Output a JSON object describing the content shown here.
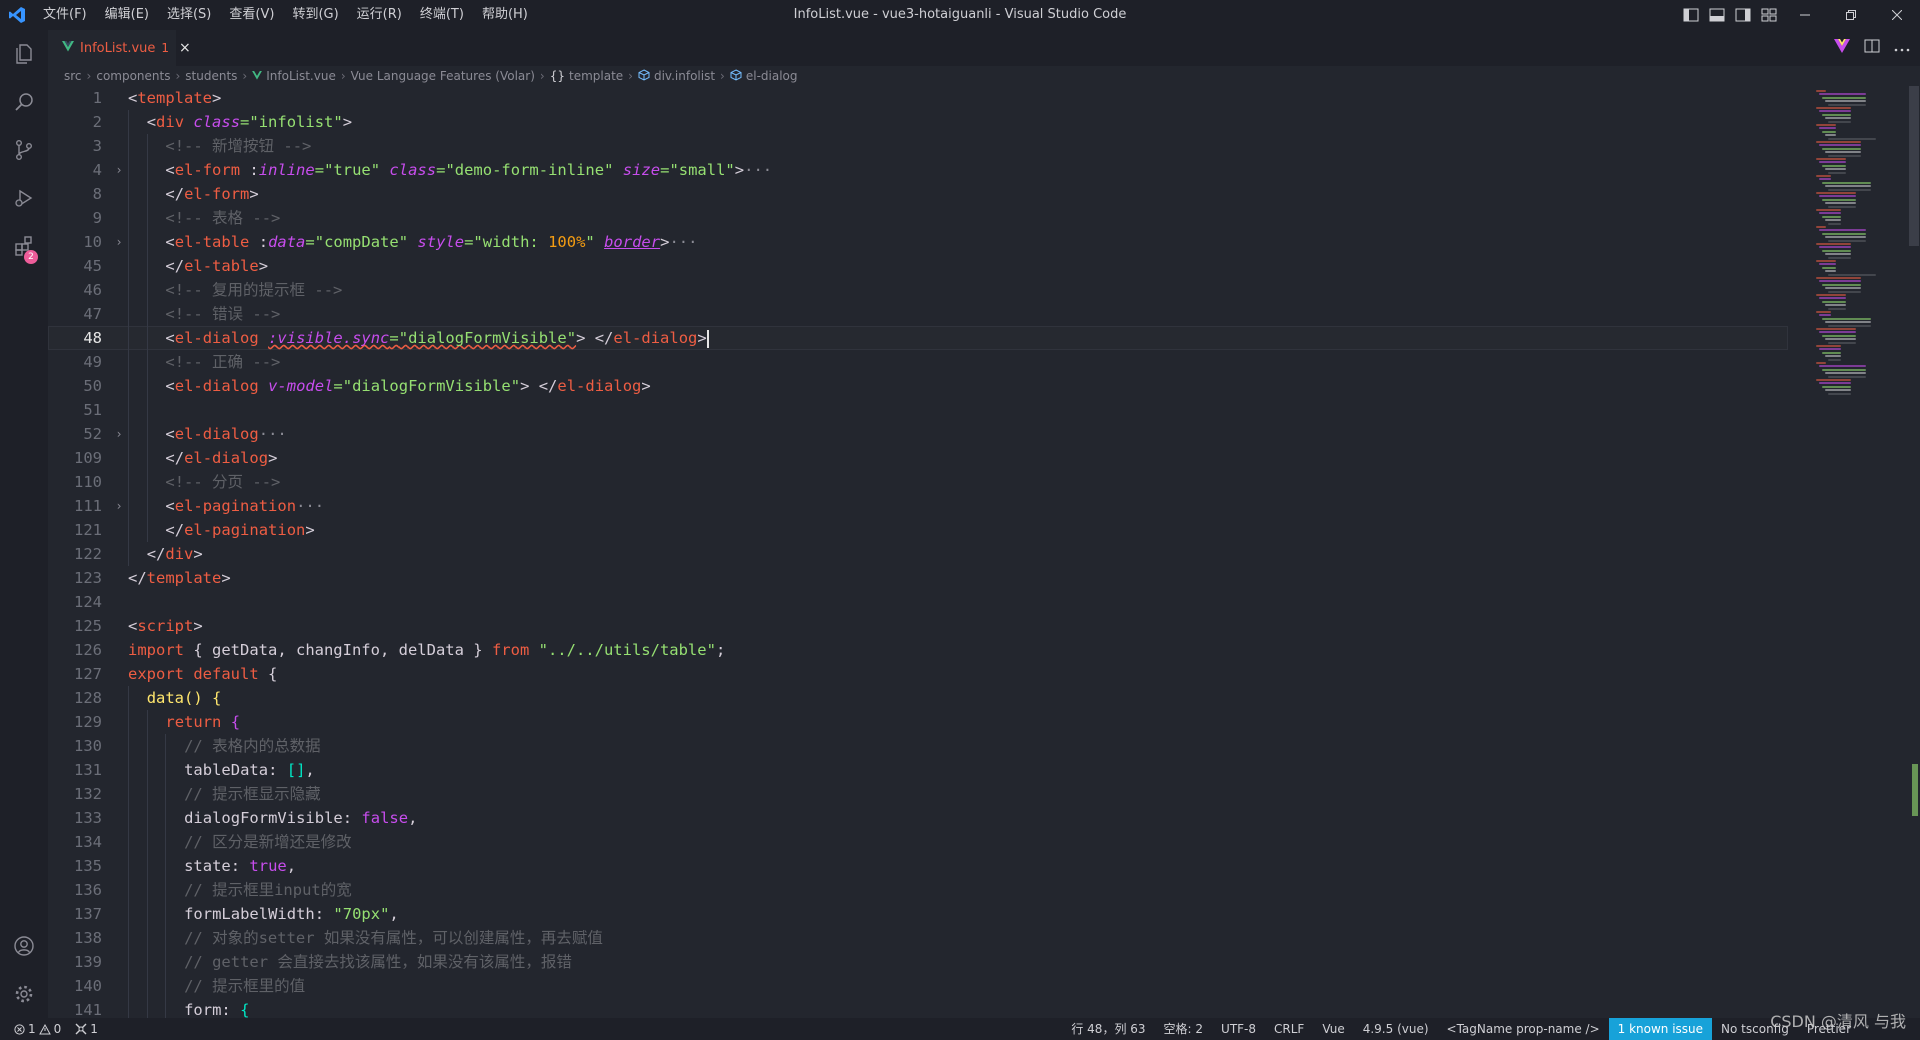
{
  "window": {
    "title": "InfoList.vue - vue3-hotaiguanli - Visual Studio Code",
    "menu": [
      "文件(F)",
      "编辑(E)",
      "选择(S)",
      "查看(V)",
      "转到(G)",
      "运行(R)",
      "终端(T)",
      "帮助(H)"
    ]
  },
  "activity": {
    "extensions_badge": "2"
  },
  "tabs": [
    {
      "label": "InfoList.vue",
      "problems": "1",
      "close": "×"
    }
  ],
  "breadcrumb": [
    "src",
    "components",
    "students",
    "InfoList.vue",
    "Vue Language Features (Volar)",
    "template",
    "div.infolist",
    "el-dialog"
  ],
  "editor": {
    "current_line": "48",
    "lines": [
      {
        "num": "1",
        "fold": "",
        "indent": 0,
        "tokens": [
          [
            "t-punc",
            "<"
          ],
          [
            "t-tag",
            "template"
          ],
          [
            "t-punc",
            ">"
          ]
        ]
      },
      {
        "num": "2",
        "fold": "",
        "indent": 1,
        "tokens": [
          [
            "t-punc",
            "<"
          ],
          [
            "t-tag",
            "div"
          ],
          [
            "t-punc",
            " "
          ],
          [
            "t-attr",
            "class"
          ],
          [
            "t-eq",
            "="
          ],
          [
            "t-str",
            "\"infolist\""
          ],
          [
            "t-punc",
            ">"
          ]
        ]
      },
      {
        "num": "3",
        "fold": "",
        "indent": 2,
        "tokens": [
          [
            "t-comment",
            "<!-- 新增按钮 -->"
          ]
        ]
      },
      {
        "num": "4",
        "fold": "›",
        "indent": 2,
        "tokens": [
          [
            "t-punc",
            "<"
          ],
          [
            "t-tag",
            "el-form"
          ],
          [
            "t-punc",
            " :"
          ],
          [
            "t-attr",
            "inline"
          ],
          [
            "t-eq",
            "="
          ],
          [
            "t-str",
            "\"true\""
          ],
          [
            "t-punc",
            " "
          ],
          [
            "t-attr",
            "class"
          ],
          [
            "t-eq",
            "="
          ],
          [
            "t-str",
            "\"demo-form-inline\""
          ],
          [
            "t-punc",
            " "
          ],
          [
            "t-attr",
            "size"
          ],
          [
            "t-eq",
            "="
          ],
          [
            "t-str",
            "\"small\""
          ],
          [
            "t-punc",
            ">"
          ],
          [
            "t-ellipsis",
            "···"
          ]
        ]
      },
      {
        "num": "8",
        "fold": "",
        "indent": 2,
        "tokens": [
          [
            "t-punc",
            "</"
          ],
          [
            "t-tag",
            "el-form"
          ],
          [
            "t-punc",
            ">"
          ]
        ]
      },
      {
        "num": "9",
        "fold": "",
        "indent": 2,
        "tokens": [
          [
            "t-comment",
            "<!-- 表格 -->"
          ]
        ]
      },
      {
        "num": "10",
        "fold": "›",
        "indent": 2,
        "tokens": [
          [
            "t-punc",
            "<"
          ],
          [
            "t-tag",
            "el-table"
          ],
          [
            "t-punc",
            " :"
          ],
          [
            "t-attr",
            "data"
          ],
          [
            "t-eq",
            "="
          ],
          [
            "t-str",
            "\"compDate\""
          ],
          [
            "t-punc",
            " "
          ],
          [
            "t-attr",
            "style"
          ],
          [
            "t-eq",
            "="
          ],
          [
            "t-str",
            "\"width: "
          ],
          [
            "t-num",
            "100%"
          ],
          [
            "t-str",
            "\""
          ],
          [
            "t-punc",
            " "
          ],
          [
            "t-attr ul",
            "border"
          ],
          [
            "t-punc",
            ">"
          ],
          [
            "t-ellipsis",
            "···"
          ]
        ]
      },
      {
        "num": "45",
        "fold": "",
        "indent": 2,
        "tokens": [
          [
            "t-punc",
            "</"
          ],
          [
            "t-tag",
            "el-table"
          ],
          [
            "t-punc",
            ">"
          ]
        ]
      },
      {
        "num": "46",
        "fold": "",
        "indent": 2,
        "tokens": [
          [
            "t-comment",
            "<!-- 复用的提示框 -->"
          ]
        ]
      },
      {
        "num": "47",
        "fold": "",
        "indent": 2,
        "tokens": [
          [
            "t-comment",
            "<!-- 错误 -->"
          ]
        ]
      },
      {
        "num": "48",
        "fold": "",
        "indent": 2,
        "tokens": [
          [
            "t-punc",
            "<"
          ],
          [
            "t-tag",
            "el-dialog"
          ],
          [
            "t-punc",
            " "
          ],
          [
            "t-attr squiggle",
            ":visible.sync"
          ],
          [
            "t-eq squiggle",
            "="
          ],
          [
            "t-str squiggle",
            "\"dialogFormVisible\""
          ],
          [
            "t-punc",
            "> </"
          ],
          [
            "t-tag",
            "el-dialog"
          ],
          [
            "t-punc",
            ">"
          ],
          [
            "caret",
            ""
          ]
        ]
      },
      {
        "num": "49",
        "fold": "",
        "indent": 2,
        "tokens": [
          [
            "t-comment",
            "<!-- 正确 -->"
          ]
        ]
      },
      {
        "num": "50",
        "fold": "",
        "indent": 2,
        "tokens": [
          [
            "t-punc",
            "<"
          ],
          [
            "t-tag",
            "el-dialog"
          ],
          [
            "t-punc",
            " "
          ],
          [
            "t-attr",
            "v-model"
          ],
          [
            "t-eq",
            "="
          ],
          [
            "t-str",
            "\"dialogFormVisible\""
          ],
          [
            "t-punc",
            "> </"
          ],
          [
            "t-tag",
            "el-dialog"
          ],
          [
            "t-punc",
            ">"
          ]
        ]
      },
      {
        "num": "51",
        "fold": "",
        "indent": 2,
        "tokens": []
      },
      {
        "num": "52",
        "fold": "›",
        "indent": 2,
        "tokens": [
          [
            "t-punc",
            "<"
          ],
          [
            "t-tag",
            "el-dialog"
          ],
          [
            "t-ellipsis",
            "···"
          ]
        ]
      },
      {
        "num": "109",
        "fold": "",
        "indent": 2,
        "tokens": [
          [
            "t-punc",
            "</"
          ],
          [
            "t-tag",
            "el-dialog"
          ],
          [
            "t-punc",
            ">"
          ]
        ]
      },
      {
        "num": "110",
        "fold": "",
        "indent": 2,
        "tokens": [
          [
            "t-comment",
            "<!-- 分页 -->"
          ]
        ]
      },
      {
        "num": "111",
        "fold": "›",
        "indent": 2,
        "tokens": [
          [
            "t-punc",
            "<"
          ],
          [
            "t-tag",
            "el-pagination"
          ],
          [
            "t-ellipsis",
            "···"
          ]
        ]
      },
      {
        "num": "121",
        "fold": "",
        "indent": 2,
        "tokens": [
          [
            "t-punc",
            "</"
          ],
          [
            "t-tag",
            "el-pagination"
          ],
          [
            "t-punc",
            ">"
          ]
        ]
      },
      {
        "num": "122",
        "fold": "",
        "indent": 1,
        "tokens": [
          [
            "t-punc",
            "</"
          ],
          [
            "t-tag",
            "div"
          ],
          [
            "t-punc",
            ">"
          ]
        ]
      },
      {
        "num": "123",
        "fold": "",
        "indent": 0,
        "tokens": [
          [
            "t-punc",
            "</"
          ],
          [
            "t-tag",
            "template"
          ],
          [
            "t-punc",
            ">"
          ]
        ]
      },
      {
        "num": "124",
        "fold": "",
        "indent": 0,
        "tokens": []
      },
      {
        "num": "125",
        "fold": "",
        "indent": 0,
        "tokens": [
          [
            "t-punc",
            "<"
          ],
          [
            "t-tag",
            "script"
          ],
          [
            "t-punc",
            ">"
          ]
        ]
      },
      {
        "num": "126",
        "fold": "",
        "indent": 0,
        "tokens": [
          [
            "t-kw",
            "import"
          ],
          [
            "t-default",
            " { getData, changInfo, delData } "
          ],
          [
            "t-kw",
            "from"
          ],
          [
            "t-default",
            " "
          ],
          [
            "t-str",
            "\"../../utils/table\""
          ],
          [
            "t-default",
            ";"
          ]
        ]
      },
      {
        "num": "127",
        "fold": "",
        "indent": 0,
        "tokens": [
          [
            "t-kw",
            "export default"
          ],
          [
            "t-default",
            " {"
          ]
        ]
      },
      {
        "num": "128",
        "fold": "",
        "indent": 1,
        "tokens": [
          [
            "t-fn",
            "data"
          ],
          [
            "t-bracket-a",
            "()"
          ],
          [
            "t-default",
            " "
          ],
          [
            "t-bracket-a",
            "{"
          ]
        ]
      },
      {
        "num": "129",
        "fold": "",
        "indent": 2,
        "tokens": [
          [
            "t-kw",
            "return"
          ],
          [
            "t-default",
            " "
          ],
          [
            "t-bracket-b",
            "{"
          ]
        ]
      },
      {
        "num": "130",
        "fold": "",
        "indent": 3,
        "tokens": [
          [
            "t-comment",
            "// 表格内的总数据"
          ]
        ]
      },
      {
        "num": "131",
        "fold": "",
        "indent": 3,
        "tokens": [
          [
            "t-default",
            "tableData: "
          ],
          [
            "t-bracket-c",
            "[]"
          ],
          [
            "t-default",
            ","
          ]
        ]
      },
      {
        "num": "132",
        "fold": "",
        "indent": 3,
        "tokens": [
          [
            "t-comment",
            "// 提示框显示隐藏"
          ]
        ]
      },
      {
        "num": "133",
        "fold": "",
        "indent": 3,
        "tokens": [
          [
            "t-default",
            "dialogFormVisible: "
          ],
          [
            "t-bool",
            "false"
          ],
          [
            "t-default",
            ","
          ]
        ]
      },
      {
        "num": "134",
        "fold": "",
        "indent": 3,
        "tokens": [
          [
            "t-comment",
            "// 区分是新增还是修改"
          ]
        ]
      },
      {
        "num": "135",
        "fold": "",
        "indent": 3,
        "tokens": [
          [
            "t-default",
            "state: "
          ],
          [
            "t-bool",
            "true"
          ],
          [
            "t-default",
            ","
          ]
        ]
      },
      {
        "num": "136",
        "fold": "",
        "indent": 3,
        "tokens": [
          [
            "t-comment",
            "// 提示框里input的宽"
          ]
        ]
      },
      {
        "num": "137",
        "fold": "",
        "indent": 3,
        "tokens": [
          [
            "t-default",
            "formLabelWidth: "
          ],
          [
            "t-str",
            "\"70px\""
          ],
          [
            "t-default",
            ","
          ]
        ]
      },
      {
        "num": "138",
        "fold": "",
        "indent": 3,
        "tokens": [
          [
            "t-comment",
            "// 对象的setter 如果没有属性，可以创建属性，再去赋值"
          ]
        ]
      },
      {
        "num": "139",
        "fold": "",
        "indent": 3,
        "tokens": [
          [
            "t-comment",
            "// getter 会直接去找该属性，如果没有该属性，报错"
          ]
        ]
      },
      {
        "num": "140",
        "fold": "",
        "indent": 3,
        "tokens": [
          [
            "t-comment",
            "// 提示框里的值"
          ]
        ]
      },
      {
        "num": "141",
        "fold": "",
        "indent": 3,
        "tokens": [
          [
            "t-default",
            "form: "
          ],
          [
            "t-bracket-c",
            "{"
          ]
        ]
      }
    ]
  },
  "statusbar": {
    "errors": "1",
    "warnings": "0",
    "ports": "1",
    "items": [
      "行 48，列 63",
      "空格: 2",
      "UTF-8",
      "CRLF",
      "Vue",
      "4.9.5 (vue)",
      "<TagName prop-name />"
    ],
    "issue": "1 known issue",
    "items_after": [
      "No tsconfig",
      "Prettier"
    ]
  },
  "watermark": "CSDN @清风 与我",
  "colors": {
    "background": "#23262e",
    "tag": "#ee5d43",
    "attribute": "#c74ded",
    "string": "#96e072",
    "function": "#ffe66d",
    "comment": "#5f6167",
    "issue_badge": "#17a2d9"
  }
}
